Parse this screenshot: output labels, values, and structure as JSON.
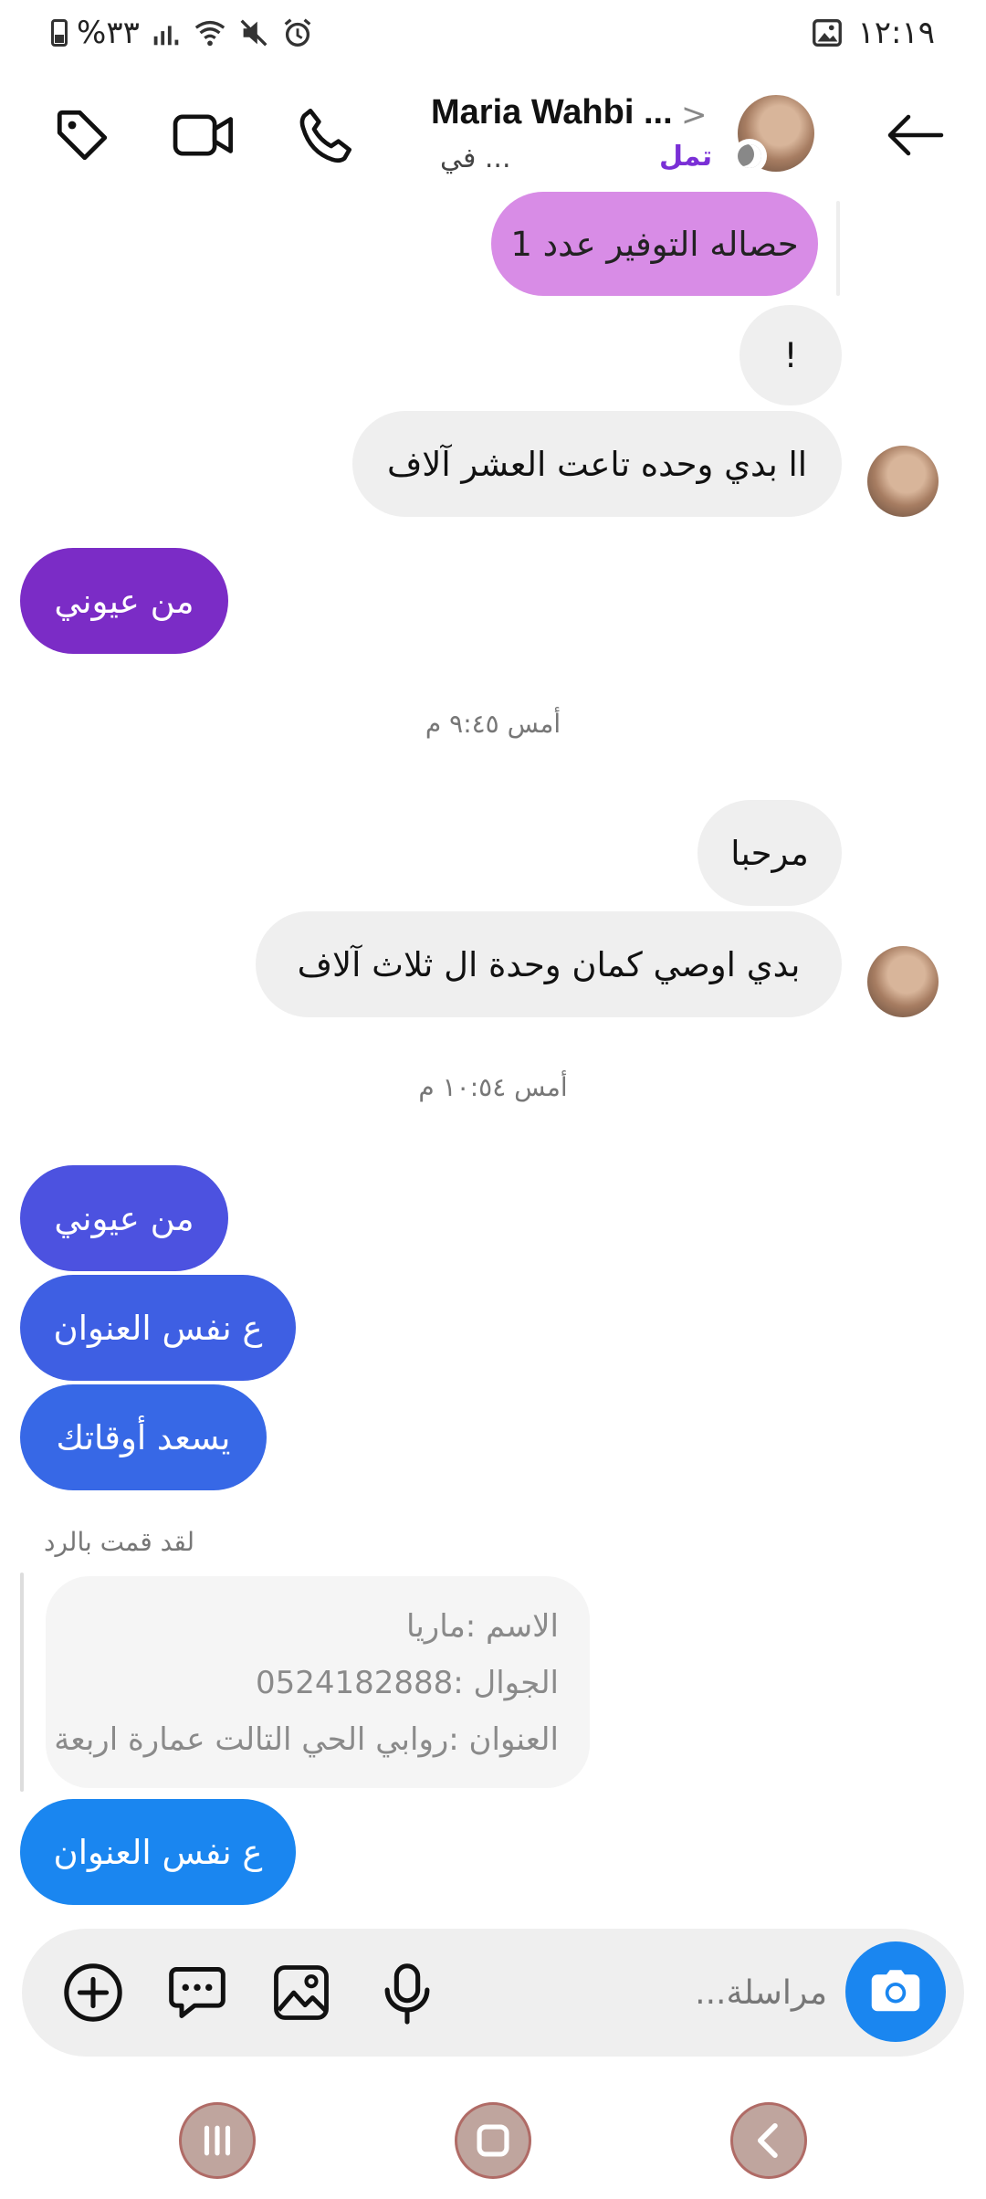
{
  "status_bar": {
    "battery": "%٣٣",
    "time": "١٢:١٩"
  },
  "header": {
    "name": "Maria Wahbi ...",
    "chevron": ">",
    "subtitle_left": "في ...",
    "subtitle_right": "تمل"
  },
  "messages": [
    {
      "text": "حصاله التوفير عدد 1",
      "from": "me"
    },
    {
      "text": "!",
      "from": "them"
    },
    {
      "text": "اا بدي وحده تاعت العشر آلاف",
      "from": "them"
    },
    {
      "text": "من عيوني",
      "from": "me"
    },
    {
      "text": "مرحبا",
      "from": "them"
    },
    {
      "text": "بدي اوصي كمان وحدة ال ثلاث آلاف",
      "from": "them"
    },
    {
      "text": "من عيوني",
      "from": "me"
    },
    {
      "text": "ع نفس العنوان",
      "from": "me"
    },
    {
      "text": "يسعد أوقاتك",
      "from": "me"
    },
    {
      "text": "ع نفس العنوان",
      "from": "me"
    }
  ],
  "timestamps": [
    "أمس ٩:٤٥ م",
    "أمس ١٠:٥٤ م"
  ],
  "reply": {
    "label": "لقد قمت بالرد",
    "quoted_lines": [
      "الاسم :ماريا",
      "الجوال :0524182888",
      "العنوان :روابي الحي التالت عمارة اربعة"
    ]
  },
  "composer": {
    "placeholder": "مراسلة..."
  },
  "colors": {
    "accent_blue": "#1a86f0",
    "purple": "#7b2cc6",
    "pink": "#d88ce6"
  }
}
